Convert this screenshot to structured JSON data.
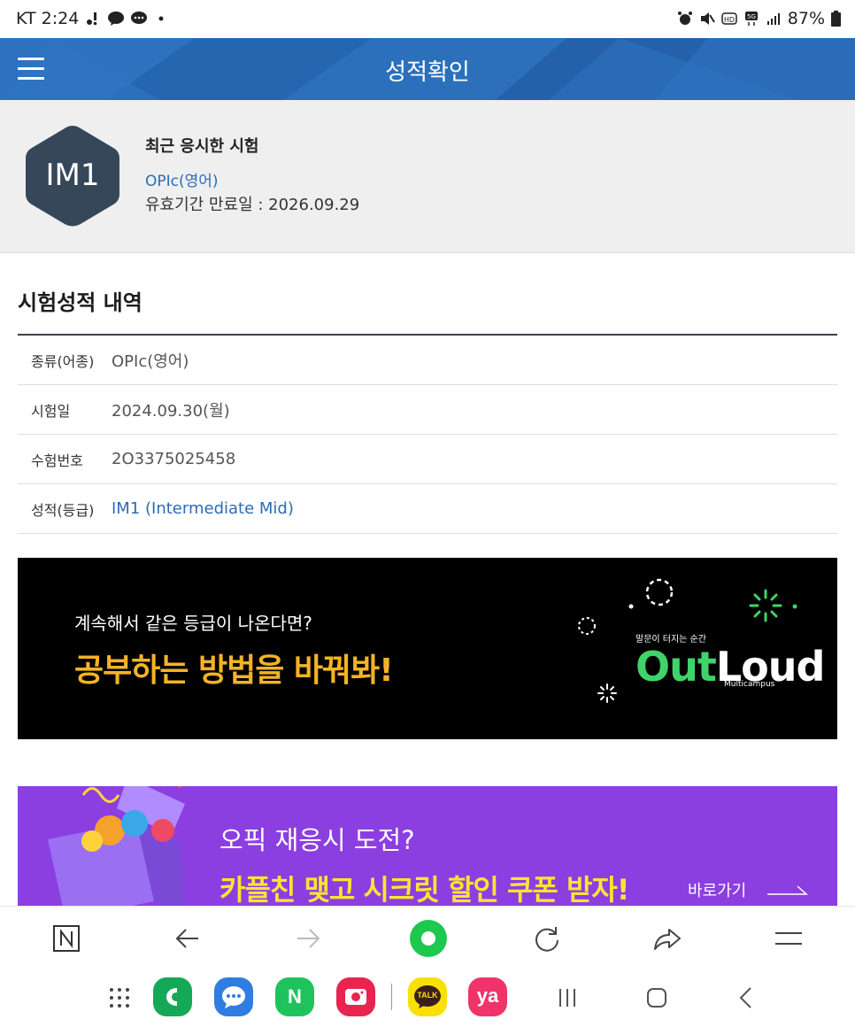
{
  "status_bar": {
    "carrier_time": "KT 2:24",
    "battery": "87%"
  },
  "header": {
    "title": "성적확인"
  },
  "summary": {
    "grade": "IM1",
    "title": "최근 응시한 시험",
    "exam_type": "OPIc(영어)",
    "expiry": "유효기간 만료일 : 2026.09.29"
  },
  "history": {
    "title": "시험성적 내역",
    "rows": [
      {
        "label": "종류(어종)",
        "value": "OPIc(영어)"
      },
      {
        "label": "시험일",
        "value": "2024.09.30(월)"
      },
      {
        "label": "수험번호",
        "value": "2O3375025458"
      },
      {
        "label": "성적(등급)",
        "value": "IM1 (Intermediate Mid)"
      }
    ]
  },
  "banner_outloud": {
    "subtitle": "계속해서 같은 등급이 나온다면?",
    "headline": "공부하는 방법을 바꿔봐!",
    "tagline": "말문이 터지는 순간",
    "brand_green": "Out",
    "brand_white": "Loud",
    "brand_sub": "Multicampus"
  },
  "banner_promo": {
    "subtitle": "오픽 재응시 도전?",
    "headline": "카플친 맺고 시크릿 할인 쿠폰 받자!",
    "link": "바로가기"
  },
  "nav_apps": {
    "naver": "N",
    "kakaotalk": "TALK",
    "yanolja": "ya"
  },
  "colors": {
    "header_blue": "#2a6cb8",
    "grade_hex": "#37475a",
    "link_blue": "#2a6cb8",
    "outloud_yellow": "#f5b324",
    "outloud_green": "#3fd36a",
    "promo_purple": "#8b3fe0",
    "promo_yellow": "#ffe234"
  }
}
